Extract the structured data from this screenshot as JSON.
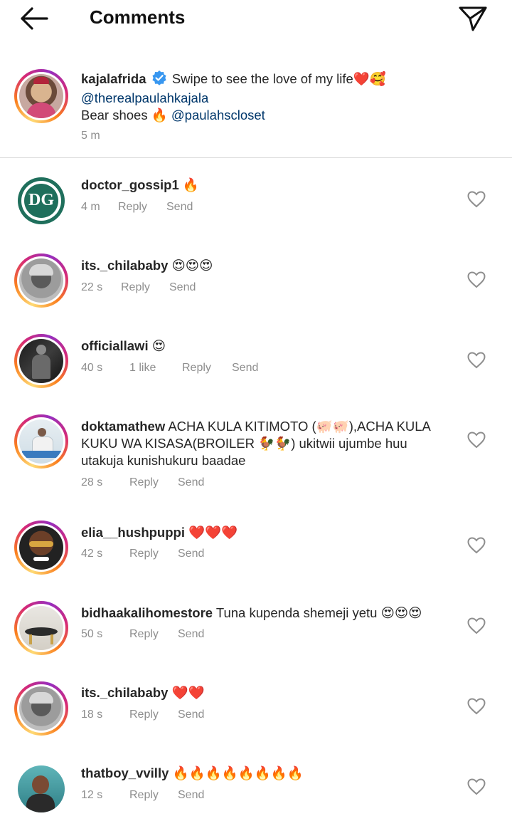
{
  "header": {
    "title": "Comments",
    "back_icon": "arrow-left-icon",
    "share_icon": "paper-plane-icon"
  },
  "caption": {
    "username": "kajalafrida",
    "verified_icon": "verified-badge-icon",
    "line1": "Swipe to see the love of my life❤️🥰",
    "mention1": "@therealpaulahkajala",
    "line3_prefix": "Bear shoes 🔥 ",
    "mention2": "@paulahscloset",
    "time": "5 m"
  },
  "comments": [
    {
      "username": "doctor_gossip1",
      "text": " 🔥",
      "time": "4 m",
      "likes": "",
      "reply": "Reply",
      "send": "Send"
    },
    {
      "username": "its._chilababy",
      "text": " 😍😍😍",
      "time": "22 s",
      "likes": "",
      "reply": "Reply",
      "send": "Send"
    },
    {
      "username": "officiallawi",
      "text": " 😍",
      "time": "40 s",
      "likes": "1 like",
      "reply": "Reply",
      "send": "Send"
    },
    {
      "username": "doktamathew",
      "text": " ACHA KULA KITIMOTO (🐖🐖),ACHA KULA KUKU WA KISASA(BROILER 🐓🐓) ukitwii ujumbe huu utakuja kunishukuru baadae",
      "time": "28 s",
      "likes": "",
      "reply": "Reply",
      "send": "Send"
    },
    {
      "username": "elia__hushpuppi",
      "text": " ❤️❤️❤️",
      "time": "42 s",
      "likes": "",
      "reply": "Reply",
      "send": "Send"
    },
    {
      "username": "bidhaakalihomestore",
      "text": " Tuna kupenda shemeji yetu 😍😍😍",
      "time": "50 s",
      "likes": "",
      "reply": "Reply",
      "send": "Send"
    },
    {
      "username": "its._chilababy",
      "text": " ❤️❤️",
      "time": "18 s",
      "likes": "",
      "reply": "Reply",
      "send": "Send"
    },
    {
      "username": "thatboy_vvilly",
      "text": " 🔥🔥🔥🔥🔥🔥🔥🔥",
      "time": "12 s",
      "likes": "",
      "reply": "Reply",
      "send": "Send"
    }
  ],
  "avatar_labels": {
    "doctor_gossip": "DG"
  },
  "colors": {
    "mention": "#00376b",
    "meta": "#8e8e8e",
    "dg_green": "#1f6f5c"
  }
}
